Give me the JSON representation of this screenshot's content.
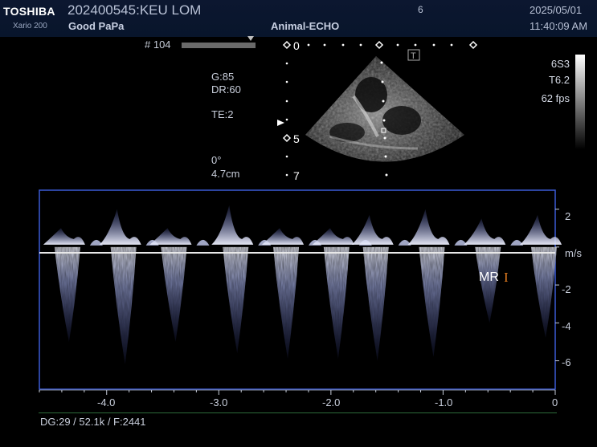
{
  "header": {
    "brand": "TOSHIBA",
    "model": "Xario 200",
    "patient_id": "202400545:KEU LOM",
    "clinic": "Good PaPa",
    "preset": "Animal-ECHO",
    "frame_no": "6",
    "date": "2025/05/01",
    "time": "11:40:09 AM"
  },
  "cine": {
    "label": "# 104",
    "position": 0.93
  },
  "image_params": {
    "gain": "G:85",
    "dynamic_range": "DR:60",
    "te": "TE:2",
    "angle": "0°",
    "depth": "4.7cm"
  },
  "probe": {
    "name": "6S3",
    "freq": "T6.2",
    "fps": "62 fps"
  },
  "depth_scale": {
    "top": "0",
    "mid": "5",
    "bottom": "7"
  },
  "doppler": {
    "y_ticks": [
      "2",
      "-2",
      "-4",
      "-6"
    ],
    "unit": "m/s",
    "x_ticks": [
      "-4.0",
      "-3.0",
      "-2.0",
      "-1.0",
      "0"
    ],
    "cursor_label": "MR",
    "cursor_glyph": "I"
  },
  "footer": {
    "info": "DG:29   / 52.1k   / F:2441"
  },
  "colors": {
    "frame": "#3b5bd6",
    "baseline": "#e8e8e8",
    "spectrum": "#c7d0ff",
    "accent": "#e07b20"
  },
  "chart_data": {
    "type": "area",
    "xlabel": "",
    "ylabel": "m/s",
    "xlim": [
      -4.6,
      0
    ],
    "ylim": [
      -7.5,
      3
    ],
    "beats": [
      {
        "t": -4.35,
        "peak": -5.0,
        "fwd": 1.0
      },
      {
        "t": -3.85,
        "peak": -6.2,
        "fwd": 2.0
      },
      {
        "t": -3.4,
        "peak": -5.0,
        "fwd": 1.0
      },
      {
        "t": -2.85,
        "peak": -5.6,
        "fwd": 2.2
      },
      {
        "t": -2.4,
        "peak": -5.9,
        "fwd": 1.0
      },
      {
        "t": -1.95,
        "peak": -5.9,
        "fwd": 1.0
      },
      {
        "t": -1.6,
        "peak": -6.0,
        "fwd": 1.7
      },
      {
        "t": -1.1,
        "peak": -5.8,
        "fwd": 2.0
      },
      {
        "t": -0.6,
        "peak": -4.0,
        "fwd": 1.5
      },
      {
        "t": -0.1,
        "peak": -4.8,
        "fwd": 1.7
      }
    ]
  }
}
